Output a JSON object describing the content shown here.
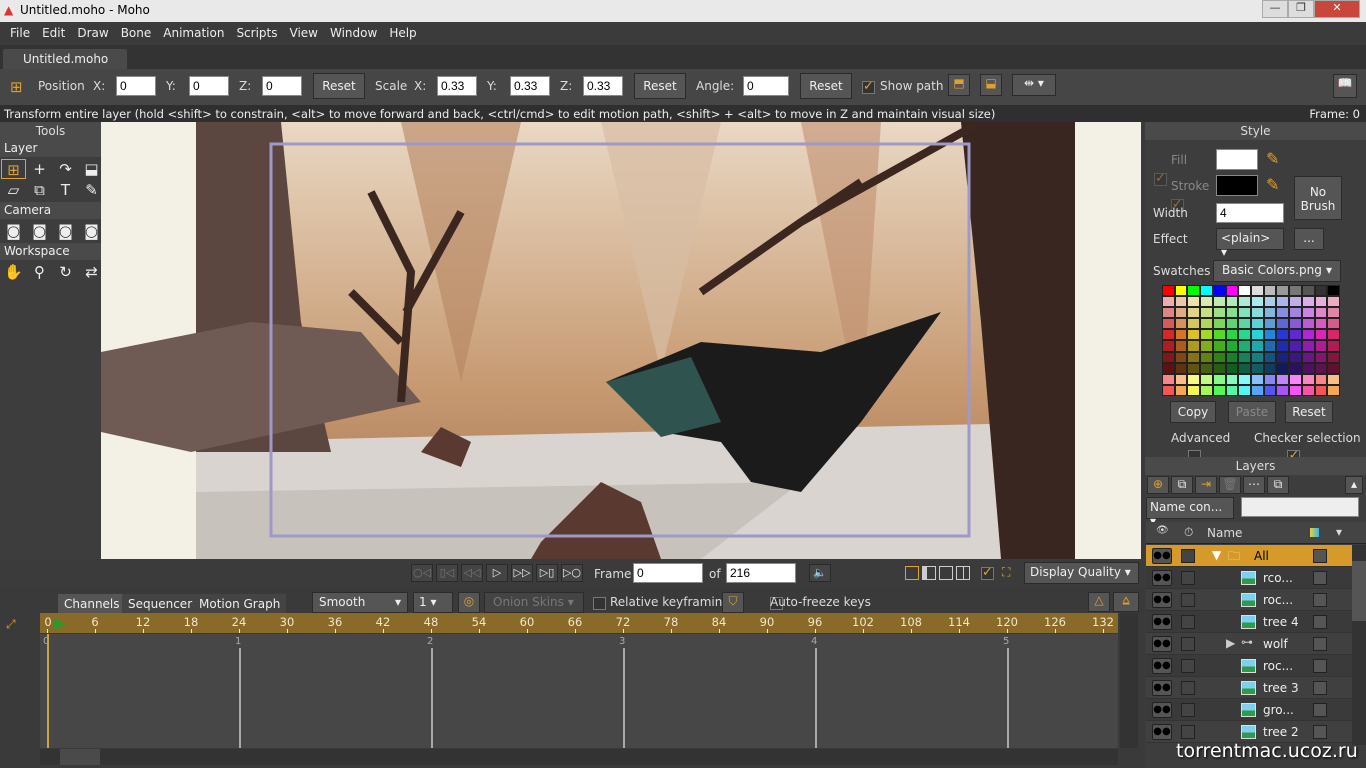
{
  "window": {
    "title": "Untitled.moho - Moho",
    "min": "—",
    "max": "❐",
    "close": "✕"
  },
  "menu": [
    "File",
    "Edit",
    "Draw",
    "Bone",
    "Animation",
    "Scripts",
    "View",
    "Window",
    "Help"
  ],
  "doc_tab": "Untitled.moho",
  "toolbar": {
    "position_label": "Position",
    "x_label": "X:",
    "x": "0",
    "y_label": "Y:",
    "y": "0",
    "z_label": "Z:",
    "z": "0",
    "reset": "Reset",
    "scale_label": "Scale",
    "sx_label": "X:",
    "sx": "0.33",
    "sy_label": "Y:",
    "sy": "0.33",
    "sz_label": "Z:",
    "sz": "0.33",
    "angle_label": "Angle:",
    "angle": "0",
    "show_path": "Show path",
    "show_path_checked": true
  },
  "status": {
    "hint": "Transform entire layer (hold <shift> to constrain, <alt> to move forward and back, <ctrl/cmd> to edit motion path, <shift> + <alt> to move in Z and maintain visual size)",
    "frame": "Frame: 0"
  },
  "tools": {
    "title": "Tools",
    "sections": [
      {
        "label": "Layer",
        "icons": [
          [
            "transform-layer-icon",
            "⊞"
          ],
          [
            "translate-icon",
            "+"
          ],
          [
            "rotate-icon",
            "↷"
          ],
          [
            "set-origin-icon",
            "⬓"
          ],
          [
            "shear-icon",
            "▱"
          ],
          [
            "select-layer-icon",
            "⧉"
          ],
          [
            "text-icon",
            "T"
          ],
          [
            "eyedropper-icon",
            "✎"
          ]
        ]
      },
      {
        "label": "Camera",
        "icons": [
          [
            "camera-track-icon",
            "◙"
          ],
          [
            "camera-zoom-icon",
            "◙"
          ],
          [
            "camera-roll-icon",
            "◙"
          ],
          [
            "camera-pan-icon",
            "◙"
          ]
        ]
      },
      {
        "label": "Workspace",
        "icons": [
          [
            "hand-icon",
            "✋"
          ],
          [
            "zoom-icon",
            "⚲"
          ],
          [
            "rotate-workspace-icon",
            "↻"
          ],
          [
            "orbit-icon",
            "⇄"
          ]
        ]
      }
    ]
  },
  "style": {
    "title": "Style",
    "fill": "Fill",
    "fill_color": "#ffffff",
    "stroke": "Stroke",
    "stroke_color": "#000000",
    "no_brush": "No Brush",
    "width_label": "Width",
    "width": "4",
    "effect_label": "Effect",
    "effect": "<plain>",
    "more": "...",
    "swatches_label": "Swatches",
    "swatches": "Basic Colors.png",
    "copy": "Copy",
    "paste": "Paste",
    "reset": "Reset",
    "advanced": "Advanced",
    "checker": "Checker selection",
    "accent": "#d59a2a"
  },
  "layers": {
    "title": "Layers",
    "filter": "Name con...",
    "col_name": "Name",
    "rows": [
      {
        "name": "All",
        "type": "folder",
        "selected": true
      },
      {
        "name": "rco...",
        "type": "image"
      },
      {
        "name": "roc...",
        "type": "image"
      },
      {
        "name": "tree 4",
        "type": "image"
      },
      {
        "name": "wolf",
        "type": "bone"
      },
      {
        "name": "roc...",
        "type": "image"
      },
      {
        "name": "tree 3",
        "type": "image"
      },
      {
        "name": "gro...",
        "type": "image"
      },
      {
        "name": "tree 2",
        "type": "image"
      }
    ]
  },
  "playback": {
    "frame_label": "Frame",
    "frame": "0",
    "of_label": "of",
    "total": "216",
    "quality": "Display Quality"
  },
  "timeline": {
    "tabs": [
      "Channels",
      "Sequencer",
      "Motion Graph"
    ],
    "interp": "Smooth",
    "interp_n": "1",
    "onion": "Onion Skins",
    "relative": "Relative keyframing",
    "autofreeze": "Auto-freeze keys",
    "ruler": [
      "0",
      "6",
      "12",
      "18",
      "24",
      "30",
      "36",
      "42",
      "48",
      "54",
      "60",
      "66",
      "72",
      "78",
      "84",
      "90",
      "96",
      "102",
      "108",
      "114",
      "120",
      "126",
      "132"
    ],
    "seconds": [
      "0",
      "1",
      "2",
      "3",
      "4",
      "5"
    ]
  },
  "watermark": "torrentmac.ucoz.ru"
}
